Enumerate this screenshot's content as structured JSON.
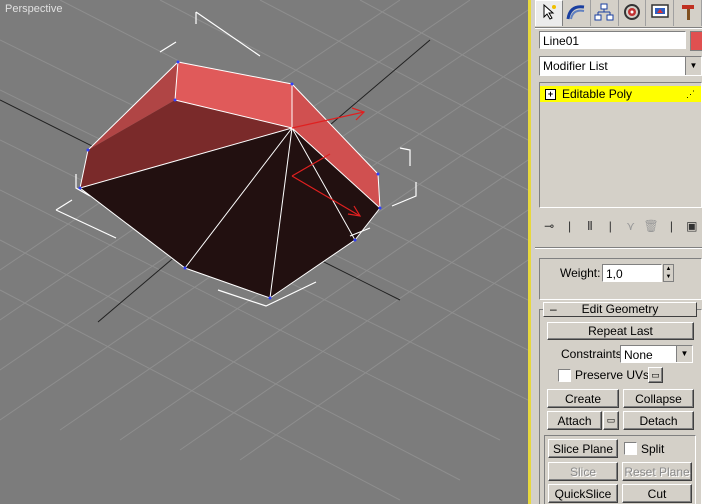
{
  "viewport": {
    "label": "Perspective"
  },
  "panel": {
    "tabs": [
      {
        "icon": "create-cursor-icon",
        "active": true
      },
      {
        "icon": "modify-arc-icon",
        "active": false
      },
      {
        "icon": "hierarchy-icon",
        "active": false
      },
      {
        "icon": "motion-icon",
        "active": false
      },
      {
        "icon": "display-icon",
        "active": false
      },
      {
        "icon": "utilities-hammer-icon",
        "active": false
      }
    ],
    "object_name": "Line01",
    "object_color": "#e05050",
    "modifier_list": "Modifier List",
    "stack_item": "Editable Poly",
    "weight_label": "Weight:",
    "weight_value": "1,0",
    "edit_geometry": {
      "title": "Edit Geometry",
      "repeat_last": "Repeat Last",
      "constraints_label": "Constraints:",
      "constraints_value": "None",
      "preserve_uvs": "Preserve UVs",
      "create": "Create",
      "collapse": "Collapse",
      "attach": "Attach",
      "detach": "Detach",
      "slice_plane": "Slice Plane",
      "split": "Split",
      "slice": "Slice",
      "reset_plane": "Reset Plane",
      "quickslice": "QuickSlice",
      "cut": "Cut"
    }
  }
}
